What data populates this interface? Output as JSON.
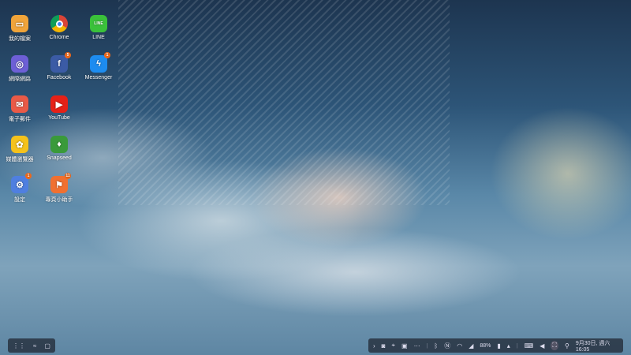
{
  "apps": [
    {
      "label": "我的檔案",
      "icon": "folder-icon",
      "color": "#f0a43a",
      "col": 0,
      "row": 0
    },
    {
      "label": "Chrome",
      "icon": "chrome-icon",
      "color": "#ffffff",
      "col": 1,
      "row": 0
    },
    {
      "label": "LINE",
      "icon": "line-icon",
      "color": "#3ac13a",
      "col": 2,
      "row": 0
    },
    {
      "label": "網際網路",
      "icon": "internet-icon",
      "color": "#6d5fd6",
      "col": 0,
      "row": 1
    },
    {
      "label": "Facebook",
      "icon": "facebook-icon",
      "color": "#3b5ba5",
      "col": 1,
      "row": 1,
      "badge": "5"
    },
    {
      "label": "Messenger",
      "icon": "messenger-icon",
      "color": "#1d8cf0",
      "col": 2,
      "row": 1,
      "badge": "1"
    },
    {
      "label": "電子郵件",
      "icon": "email-icon",
      "color": "#ea5a47",
      "col": 0,
      "row": 2
    },
    {
      "label": "YouTube",
      "icon": "youtube-icon",
      "color": "#e62117",
      "col": 1,
      "row": 2
    },
    {
      "label": "媒體瀏覽器",
      "icon": "gallery-icon",
      "color": "#f5c21b",
      "col": 0,
      "row": 3
    },
    {
      "label": "Snapseed",
      "icon": "snapseed-icon",
      "color": "#3a9a3a",
      "col": 1,
      "row": 3
    },
    {
      "label": "設定",
      "icon": "gear-icon",
      "color": "#4f7fe0",
      "col": 0,
      "row": 4,
      "badge": "1"
    },
    {
      "label": "專頁小助手",
      "icon": "pages-manager-icon",
      "color": "#f07030",
      "col": 1,
      "row": 4,
      "badge": "11"
    }
  ],
  "taskbar": {
    "left": [
      "apps-grid-icon",
      "recent-apps-icon",
      "home-square-icon"
    ],
    "tray": {
      "battery": "88%",
      "datetime": "9月30日, 週六 16:05"
    }
  }
}
